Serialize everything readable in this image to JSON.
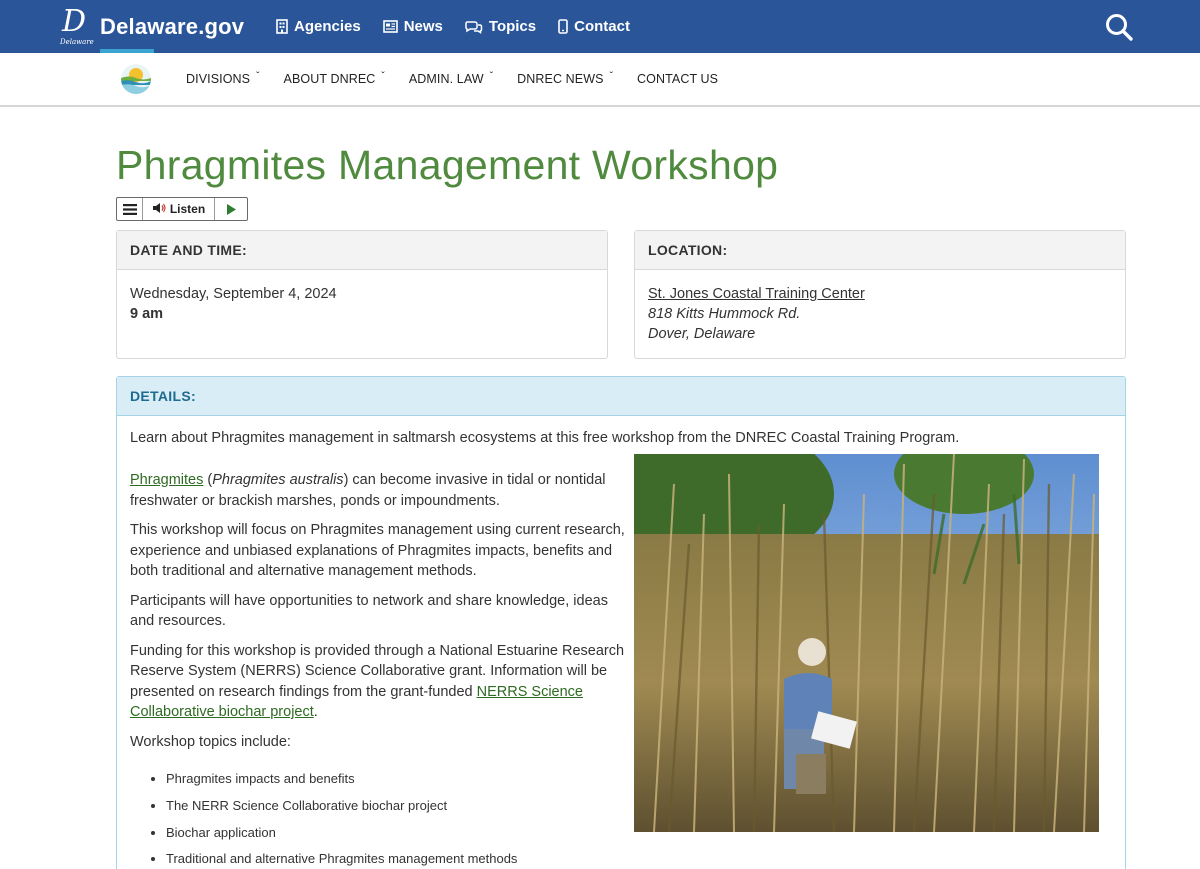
{
  "header": {
    "brand": "Delaware.gov",
    "brand_sub": "Delaware",
    "nav": [
      {
        "label": "Agencies",
        "icon": "building-icon"
      },
      {
        "label": "News",
        "icon": "newspaper-icon"
      },
      {
        "label": "Topics",
        "icon": "chat-icon"
      },
      {
        "label": "Contact",
        "icon": "phone-icon"
      }
    ],
    "search_icon": "search-icon",
    "color": "#2a5599"
  },
  "subnav": {
    "items": [
      {
        "label": "DIVISIONS",
        "caret": "ˇ"
      },
      {
        "label": "ABOUT DNREC",
        "caret": "ˇ"
      },
      {
        "label": "ADMIN. LAW",
        "caret": "ˇ"
      },
      {
        "label": "DNREC NEWS",
        "caret": "ˇ"
      },
      {
        "label": "CONTACT US",
        "caret": ""
      }
    ]
  },
  "page": {
    "title": "Phragmites Management Workshop",
    "title_color": "#4f8a3e"
  },
  "listen": {
    "label": "Listen"
  },
  "date_card": {
    "heading": "DATE AND TIME:",
    "date": "Wednesday, September 4, 2024",
    "time": "9 am"
  },
  "location_card": {
    "heading": "LOCATION:",
    "venue": "St. Jones Coastal Training Center",
    "street": "818 Kitts Hummock Rd.",
    "city": "Dover, Delaware"
  },
  "details": {
    "heading": "DETAILS:",
    "intro": "Learn about Phragmites management in saltmarsh ecosystems at this free workshop from the DNREC Coastal Training Program.",
    "p1_link": "Phragmites",
    "p1_paren_open": " (",
    "p1_italic": "Phragmites australis",
    "p1_rest": ") can become invasive in tidal or nontidal freshwater or brackish marshes, ponds or impoundments.",
    "p2": "This workshop will focus on Phragmites management using current research, experience and unbiased explanations of Phragmites impacts, benefits and both traditional and alternative management methods.",
    "p3": "Participants will have opportunities to network and share knowledge, ideas and resources.",
    "p4": "Funding for this workshop is provided through a National Estuarine Research Reserve System (NERRS) Science Collaborative grant. Information will be presented on research findings from the grant-funded ",
    "p4_link": "NERRS Science Collaborative biochar project",
    "p4_end": ".",
    "topics_intro": "Workshop topics include:",
    "topics": [
      "Phragmites impacts and benefits",
      "The NERR Science Collaborative biochar project",
      "Biochar application",
      "Traditional and alternative Phragmites management methods"
    ]
  }
}
